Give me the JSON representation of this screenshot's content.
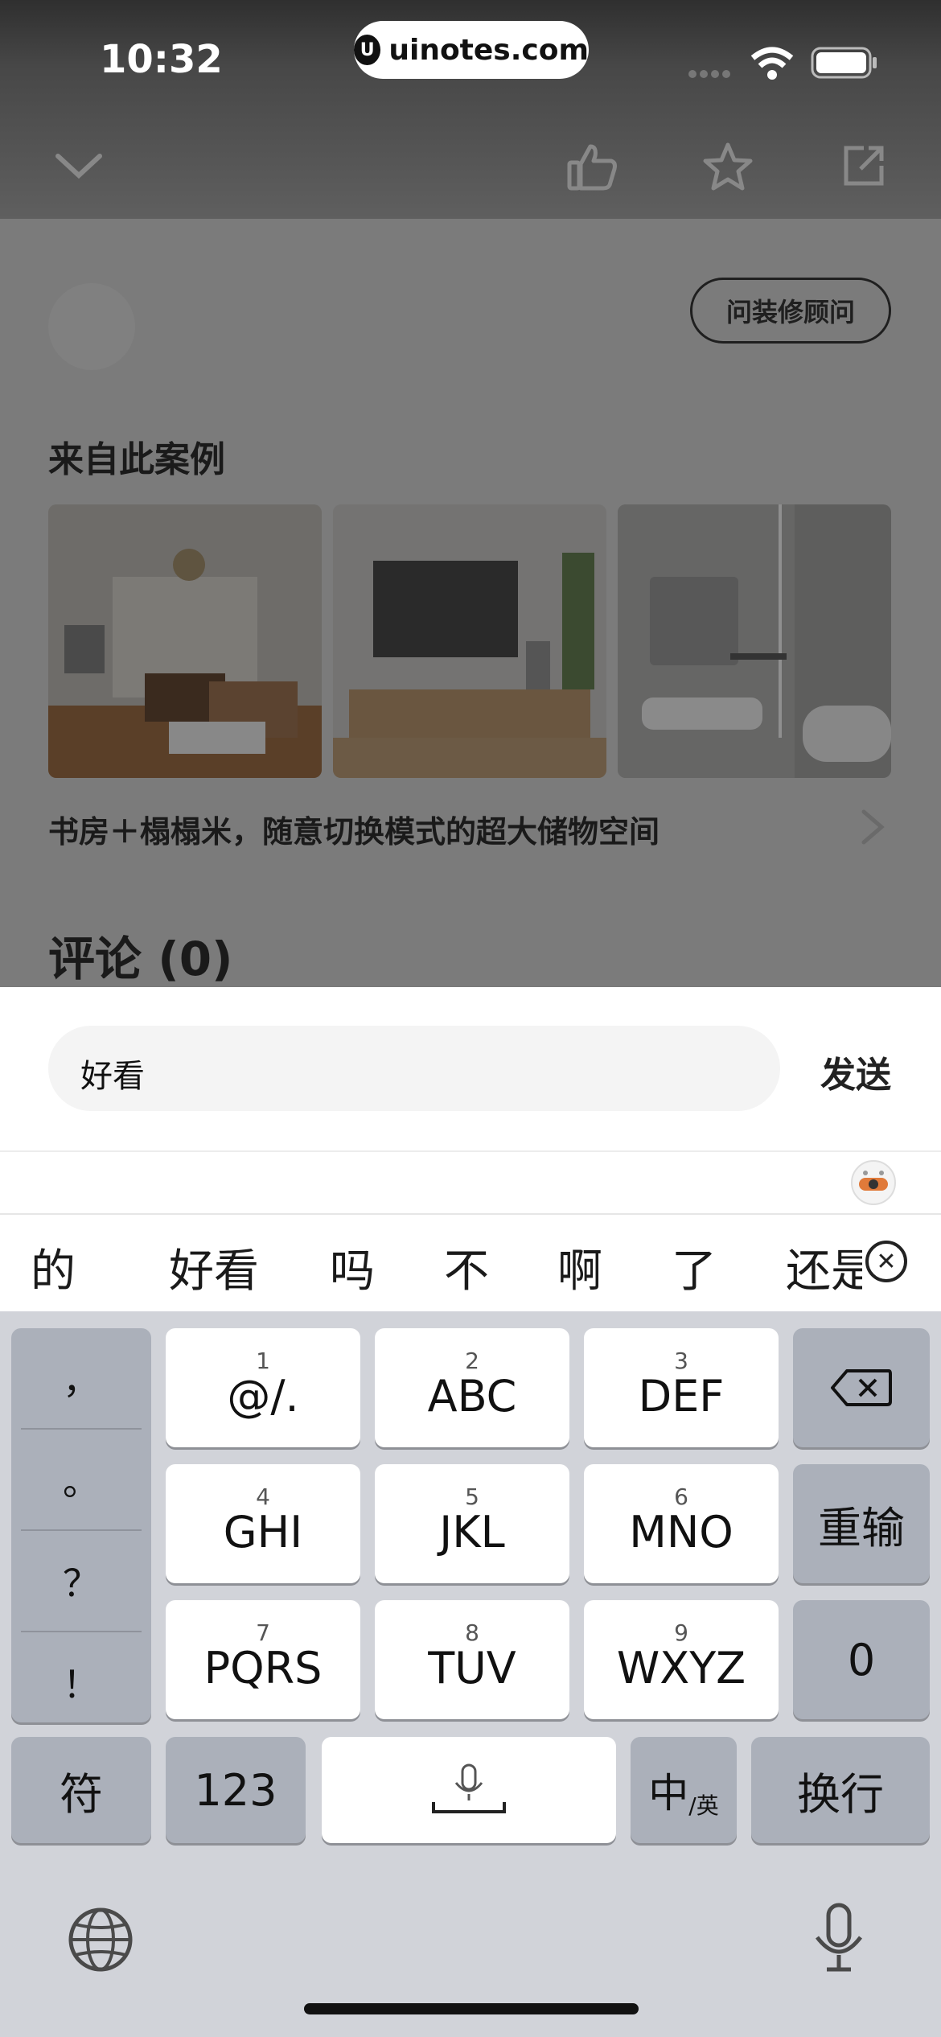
{
  "status_bar": {
    "time": "10:32",
    "url": "uinotes.com"
  },
  "nav": {
    "back_icon": "chevron-down-icon",
    "like_icon": "thumbs-up-icon",
    "star_icon": "star-icon",
    "share_icon": "share-icon"
  },
  "advisor_button": "问装修顾问",
  "section_title": "来自此案例",
  "case_title": "书房＋榻榻米，随意切换模式的超大储物空间",
  "comments_header": "评论 (0)",
  "comment_input": {
    "value": "好看"
  },
  "send_label": "发送",
  "candidates": [
    "的",
    "好看",
    "吗",
    "不",
    "啊",
    "了",
    "还是"
  ],
  "keyboard": {
    "punctuation": [
      "，",
      "。",
      "？",
      "！"
    ],
    "keys": [
      {
        "num": "1",
        "letters": "@/."
      },
      {
        "num": "2",
        "letters": "ABC"
      },
      {
        "num": "3",
        "letters": "DEF"
      },
      {
        "num": "4",
        "letters": "GHI"
      },
      {
        "num": "5",
        "letters": "JKL"
      },
      {
        "num": "6",
        "letters": "MNO"
      },
      {
        "num": "7",
        "letters": "PQRS"
      },
      {
        "num": "8",
        "letters": "TUV"
      },
      {
        "num": "9",
        "letters": "WXYZ"
      }
    ],
    "reenter": "重输",
    "zero": "0",
    "symbols": "符",
    "numbers": "123",
    "lang_main": "中",
    "lang_sub": "/英",
    "return": "换行"
  }
}
